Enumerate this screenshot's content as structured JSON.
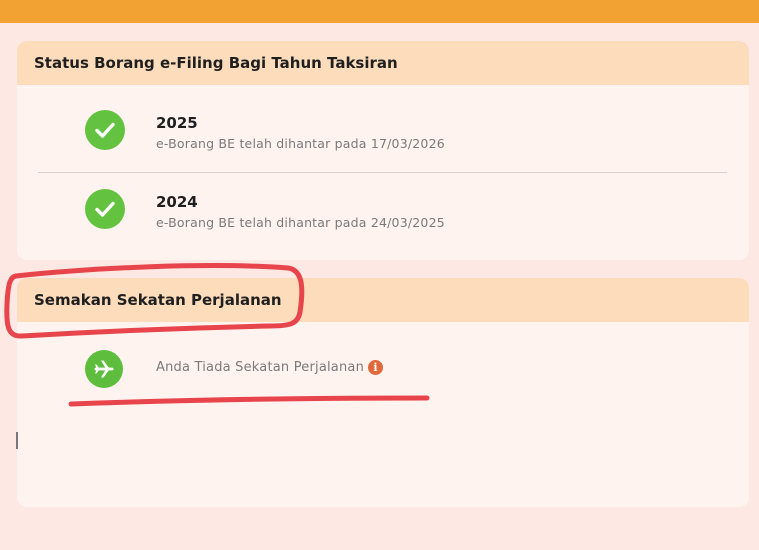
{
  "status_section": {
    "title": "Status Borang e-Filing Bagi Tahun Taksiran",
    "entries": [
      {
        "year": "2025",
        "description": "e-Borang BE telah dihantar pada 17/03/2026"
      },
      {
        "year": "2024",
        "description": "e-Borang BE telah dihantar pada 24/03/2025"
      }
    ]
  },
  "travel_section": {
    "title": "Semakan Sekatan Perjalanan",
    "message": "Anda Tiada Sekatan Perjalanan",
    "info_glyph": "i"
  },
  "icons": {
    "status": "check-icon",
    "travel": "airplane-icon",
    "info": "info-icon"
  },
  "colors": {
    "top_bar": "#f2a233",
    "header_band": "#fddcbc",
    "success_green": "#63c23f",
    "info_orange": "#e0683a",
    "annotation_red": "#e8444c"
  }
}
